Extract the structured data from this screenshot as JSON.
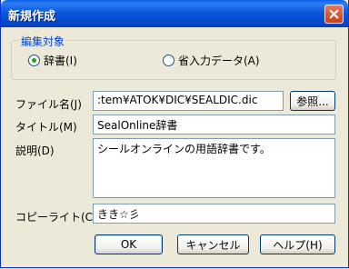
{
  "title": "新規作成",
  "group": {
    "label": "編集対象",
    "options": [
      {
        "label": "辞書(I)",
        "selected": true
      },
      {
        "label": "省入力データ(A)",
        "selected": false
      }
    ]
  },
  "fields": {
    "filename": {
      "label": "ファイル名(J)",
      "value": ":tem¥ATOK¥DIC¥SEALDIC.dic"
    },
    "title": {
      "label": "タイトル(M)",
      "value": "SealOnline辞書"
    },
    "description": {
      "label": "説明(D)",
      "value": "シールオンラインの用語辞書です。"
    },
    "copyright": {
      "label": "コピーライト(C)",
      "value": "きき☆彡"
    }
  },
  "buttons": {
    "browse": "参照...",
    "ok": "OK",
    "cancel": "キャンセル",
    "help": "ヘルプ(H)"
  },
  "colors": {
    "accent": "#0046d5",
    "titlebar": "#0a55da",
    "radio_dot": "#21a121"
  }
}
